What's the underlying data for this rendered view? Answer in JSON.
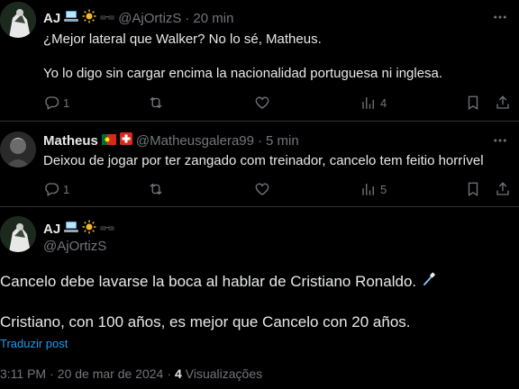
{
  "tweet1": {
    "name": "AJ",
    "handle": "@AjOrtizS",
    "dot": "·",
    "time": "20 min",
    "line1": "¿Mejor lateral que Walker? No lo sé, Matheus.",
    "line2": "Yo lo digo sin cargar encima la nacionalidad portuguesa ni inglesa.",
    "replies": "1",
    "views": "4"
  },
  "tweet2": {
    "name": "Matheus",
    "handle": "@Matheusgalera99",
    "dot": "·",
    "time": "5 min",
    "line1": "Deixou de jogar por ter zangado com treinador, cancelo tem feitio horrível",
    "replies": "1",
    "views": "5"
  },
  "main": {
    "name": "AJ",
    "handle": "@AjOrtizS",
    "line1": "Cancelo debe lavarse la boca al hablar de Cristiano Ronaldo.",
    "line2": "Cristiano, con 100 años, es mejor que Cancelo con 20 años.",
    "translate": "Traduzir post",
    "time": "3:11 PM",
    "sep": "·",
    "date": "20 de mar de 2024",
    "views_count": "4",
    "views_label": "Visualizações"
  },
  "colors": {
    "text": "#e7e9ea",
    "muted": "#71767b",
    "link": "#1d9bf0",
    "border": "#2f3336",
    "bg": "#000000"
  }
}
